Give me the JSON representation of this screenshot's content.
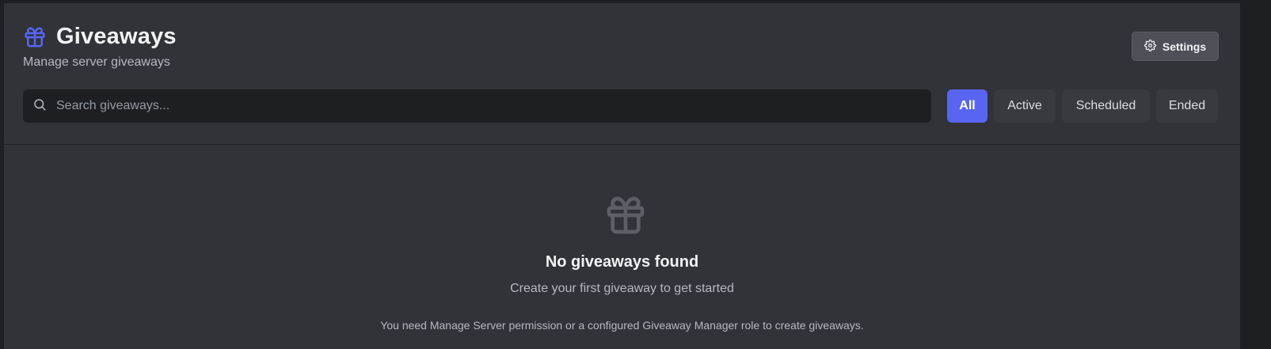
{
  "header": {
    "title": "Giveaways",
    "subtitle": "Manage server giveaways",
    "title_icon": "gift-icon"
  },
  "toolbar": {
    "settings_label": "Settings",
    "settings_icon": "gear-icon"
  },
  "search": {
    "placeholder": "Search giveaways...",
    "value": ""
  },
  "filters": {
    "all": "All",
    "active": "Active",
    "scheduled": "Scheduled",
    "ended": "Ended",
    "selected": "All"
  },
  "empty_state": {
    "icon": "gift-icon",
    "title": "No giveaways found",
    "subtitle": "Create your first giveaway to get started",
    "note": "You need Manage Server permission or a configured Giveaway Manager role to create giveaways."
  },
  "colors": {
    "accent": "#5865f2",
    "background": "#313338",
    "input_background": "#1e1f22"
  }
}
